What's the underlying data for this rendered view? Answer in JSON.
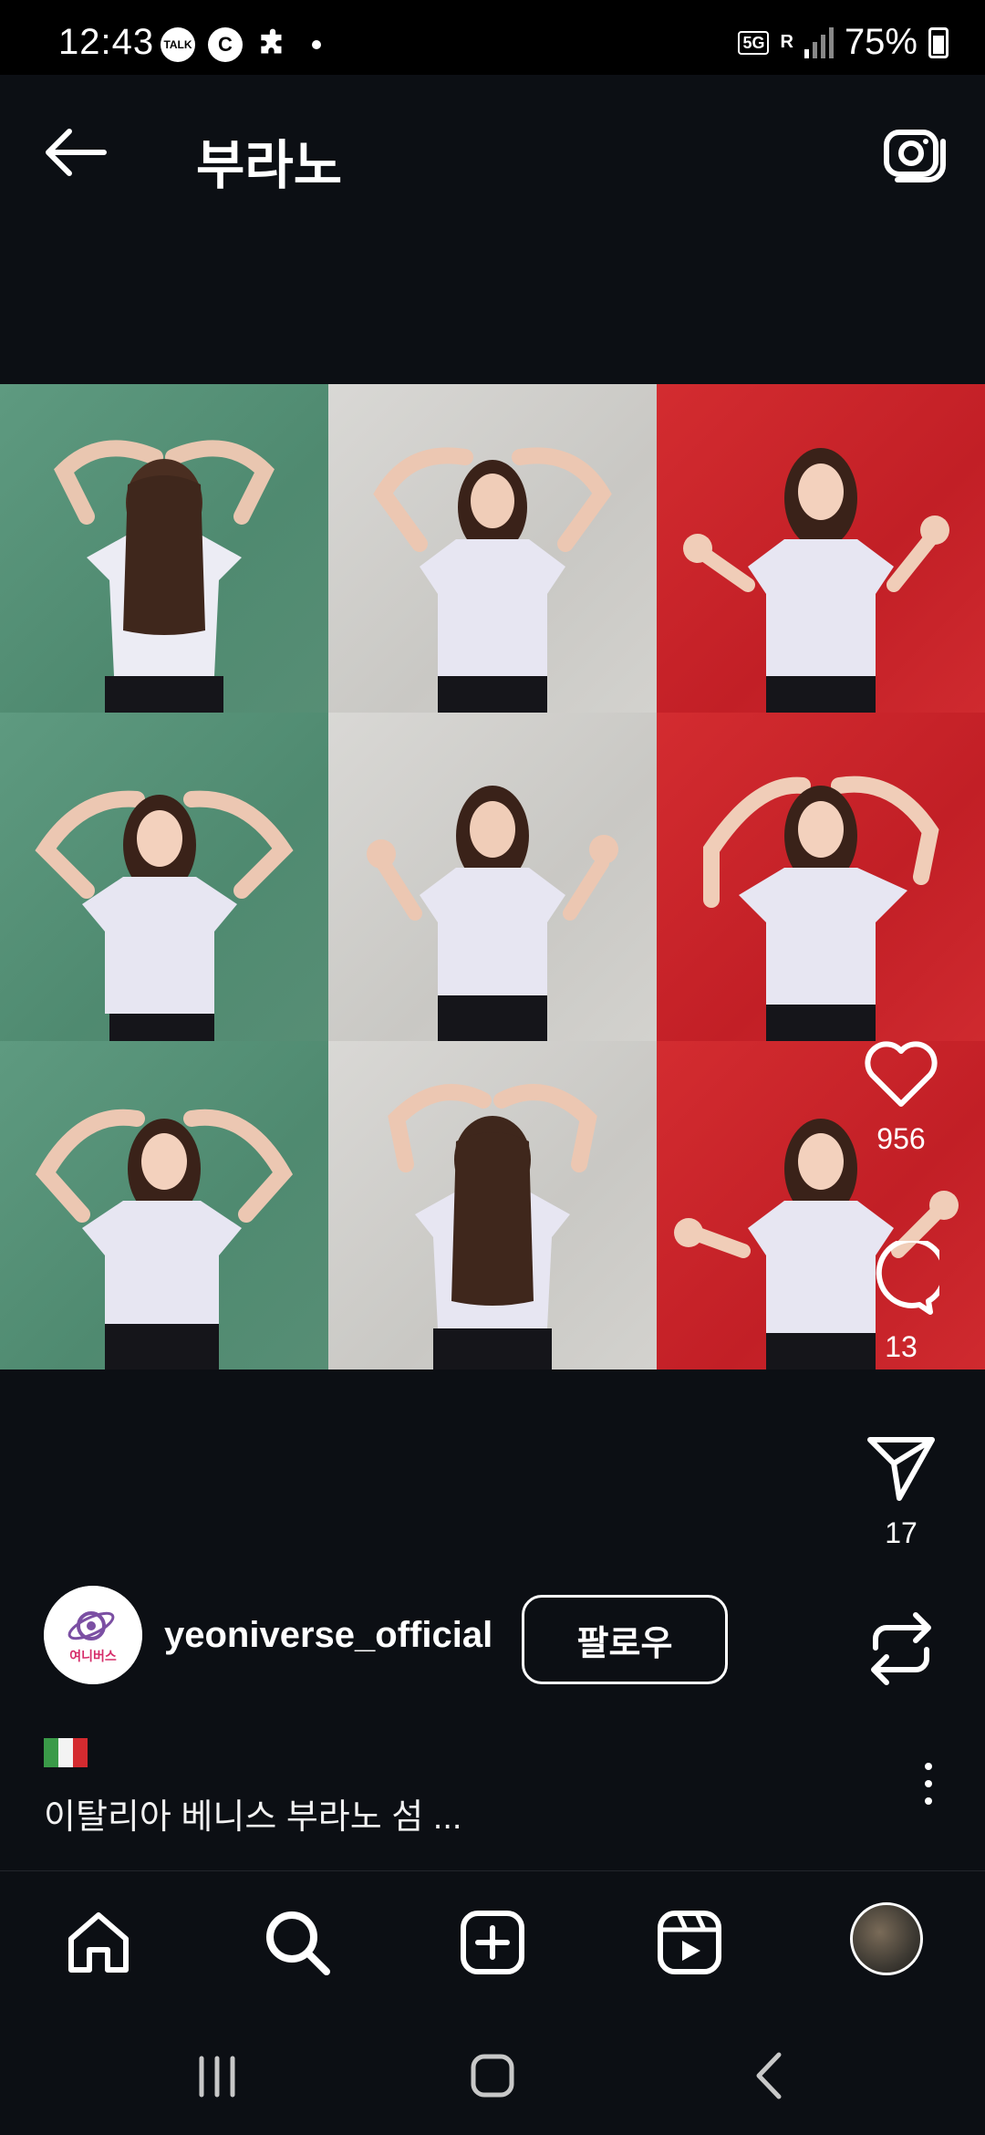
{
  "status_bar": {
    "time": "12:43",
    "talk_badge": "TALK",
    "c_badge": "C",
    "network": "5G",
    "roaming": "R",
    "battery": "75%"
  },
  "header": {
    "title": "부라노"
  },
  "post": {
    "grid_colors": [
      "#5b9880",
      "#d3d2cf",
      "#cc2a2e"
    ],
    "likes": "956",
    "comments": "13",
    "shares": "17",
    "author": {
      "username": "yeoniverse_official",
      "avatar_text": "여니버스"
    },
    "follow_label": "팔로우",
    "caption_flag": "🇮🇹",
    "caption": "이탈리아 베니스 부라노 섬 ..."
  },
  "bottom_nav": {
    "items": [
      "home",
      "search",
      "create",
      "reels",
      "profile"
    ]
  },
  "colors": {
    "background": "#0c0f14",
    "text": "#ffffff"
  }
}
